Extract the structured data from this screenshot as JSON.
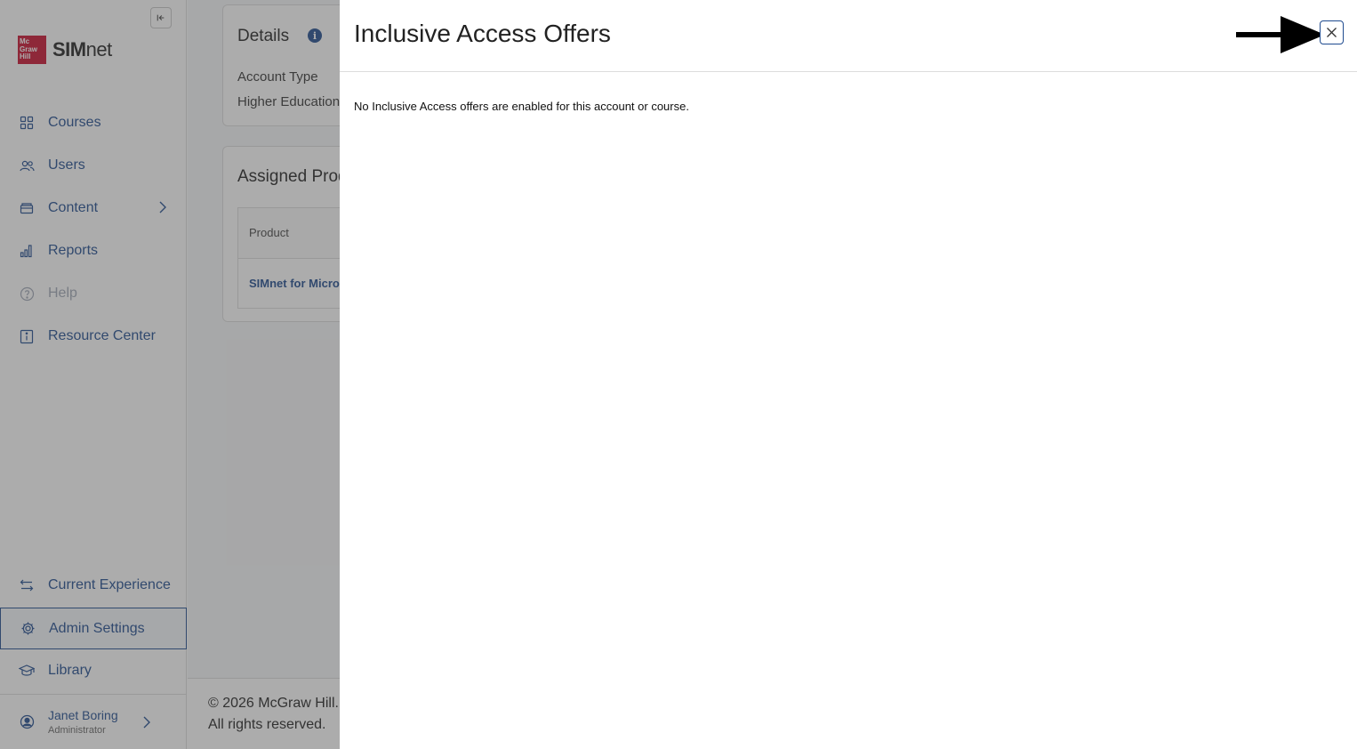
{
  "brand": {
    "logo_mark": "Mc Graw Hill",
    "logo_bold": "SIM",
    "logo_light": "net"
  },
  "sidebar": {
    "collapse_icon": "collapse-left-icon",
    "items": [
      {
        "label": "Courses",
        "icon": "grid-icon"
      },
      {
        "label": "Users",
        "icon": "users-icon"
      },
      {
        "label": "Content",
        "icon": "box-icon"
      },
      {
        "label": "Reports",
        "icon": "bar-chart-icon"
      },
      {
        "label": "Help",
        "icon": "help-icon"
      },
      {
        "label": "Resource Center",
        "icon": "info-icon"
      }
    ],
    "bottom_items": [
      {
        "label": "Current Experience",
        "icon": "swap-icon"
      },
      {
        "label": "Admin Settings",
        "icon": "gear-icon"
      },
      {
        "label": "Library",
        "icon": "graduation-cap-icon"
      }
    ],
    "user": {
      "name": "Janet Boring",
      "role": "Administrator"
    }
  },
  "main": {
    "details": {
      "title": "Details",
      "account_type_label": "Account Type",
      "account_type_value": "Higher Education"
    },
    "assigned_products": {
      "title": "Assigned Products",
      "column_product": "Product",
      "row_product": "SIMnet for Microsoft Office"
    },
    "footer": {
      "copyright": "© 2026 McGraw Hill.",
      "rights": "All rights reserved."
    }
  },
  "dialog": {
    "title": "Inclusive Access Offers",
    "message": "No Inclusive Access offers are enabled for this account or course.",
    "close_icon": "close-icon",
    "accent": "#1f4b8f"
  }
}
